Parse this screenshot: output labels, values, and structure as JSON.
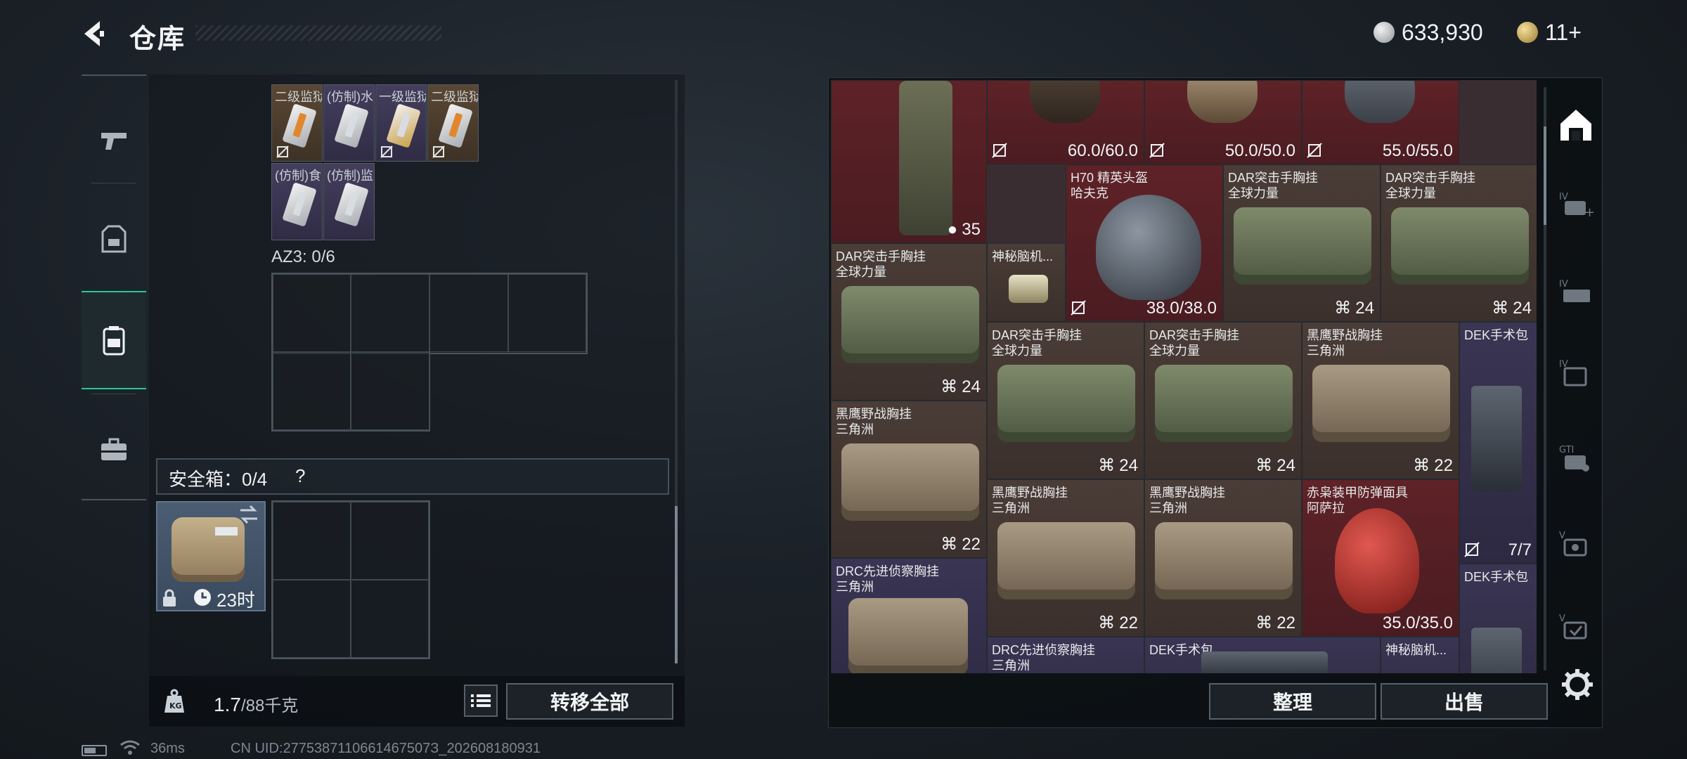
{
  "header": {
    "title": "仓库",
    "currency_1": "633,930",
    "currency_2": "11+"
  },
  "backpack": {
    "consumables": [
      {
        "label": "二级监狱...",
        "rarity": "orange"
      },
      {
        "label": "(仿制)水...",
        "rarity": "purple"
      },
      {
        "label": "一级监狱...",
        "rarity": "purple"
      },
      {
        "label": "二级监狱...",
        "rarity": "orange"
      },
      {
        "label": "(仿制)食...",
        "rarity": "purple"
      },
      {
        "label": "(仿制)监...",
        "rarity": "purple"
      }
    ],
    "az3_label": "AZ3: 0/6",
    "safebox_label": "安全箱：0/4",
    "safebox_help": "?",
    "safebox_timer": "23时",
    "weight": "1.7",
    "weight_capacity": "/88千克",
    "transfer_all": "转移全部"
  },
  "warehouse": {
    "items": [
      {
        "name": "",
        "sub": "",
        "value": "35"
      },
      {
        "name": "",
        "sub": "",
        "value": "60.0/60.0"
      },
      {
        "name": "",
        "sub": "",
        "value": "50.0/50.0"
      },
      {
        "name": "",
        "sub": "",
        "value": "55.0/55.0"
      },
      {
        "name": "H70 精英头盔",
        "sub": "哈夫克",
        "value": "38.0/38.0"
      },
      {
        "name": "DAR突击手胸挂",
        "sub": "全球力量",
        "value": "24"
      },
      {
        "name": "DAR突击手胸挂",
        "sub": "全球力量",
        "value": "24"
      },
      {
        "name": "DAR突击手胸挂",
        "sub": "全球力量",
        "value": "24"
      },
      {
        "name": "神秘脑机...",
        "sub": "",
        "value": ""
      },
      {
        "name": "DAR突击手胸挂",
        "sub": "全球力量",
        "value": "24"
      },
      {
        "name": "DAR突击手胸挂",
        "sub": "全球力量",
        "value": "24"
      },
      {
        "name": "黑鹰野战胸挂",
        "sub": "三角洲",
        "value": "22"
      },
      {
        "name": "DEK手术包",
        "sub": "",
        "value": "7/7"
      },
      {
        "name": "黑鹰野战胸挂",
        "sub": "三角洲",
        "value": "22"
      },
      {
        "name": "黑鹰野战胸挂",
        "sub": "三角洲",
        "value": "22"
      },
      {
        "name": "黑鹰野战胸挂",
        "sub": "三角洲",
        "value": "22"
      },
      {
        "name": "赤枭装甲防弹面具",
        "sub": "阿萨拉",
        "value": "35.0/35.0"
      },
      {
        "name": "DRC先进侦察胸挂",
        "sub": "三角洲",
        "value": ""
      },
      {
        "name": "DEK手术包",
        "sub": "",
        "value": ""
      },
      {
        "name": "DRC先进侦察胸挂",
        "sub": "三角洲",
        "value": ""
      },
      {
        "name": "DEK手术包",
        "sub": "",
        "value": ""
      },
      {
        "name": "神秘脑机...",
        "sub": "",
        "value": ""
      }
    ],
    "sort_label": "整理",
    "sell_label": "出售"
  },
  "status": {
    "ping": "36ms",
    "uid": "CN UID:2775387110661467507З_202608180931"
  },
  "colors": {
    "accent": "#28c99a",
    "rarity_red": "#5e2227",
    "rarity_purple": "#3a3553",
    "rarity_orange": "#5a4733"
  }
}
